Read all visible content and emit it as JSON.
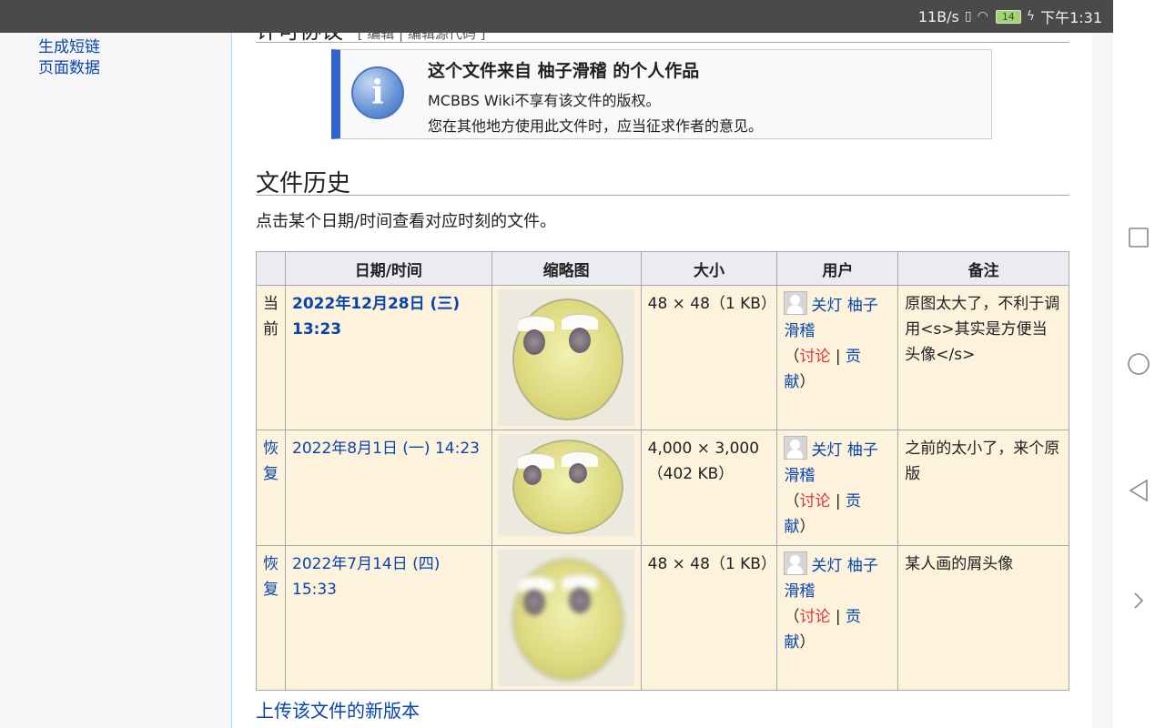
{
  "status_bar": {
    "speed": "11B/s",
    "battery": "14",
    "time": "下午1:31"
  },
  "sidebar": {
    "items": [
      {
        "label": "生成短链"
      },
      {
        "label": "页面数据"
      }
    ]
  },
  "prev_section": {
    "title": "许可协议",
    "edit_links": "[ 编辑 | 编辑源代码 ]"
  },
  "license": {
    "title": "这个文件来自 柚子滑稽 的个人作品",
    "line1": "MCBBS Wiki不享有该文件的版权。",
    "line2": "您在其他地方使用此文件时，应当征求作者的意见。"
  },
  "history": {
    "heading": "文件历史",
    "intro": "点击某个日期/时间查看对应时刻的文件。",
    "columns": [
      "",
      "日期/时间",
      "缩略图",
      "大小",
      "用户",
      "备注"
    ],
    "rows": [
      {
        "status": "当前",
        "date": "2022年12月28日 (三) 13:23",
        "size": "48 × 48（1 KB）",
        "user": "关灯 柚子滑稽",
        "talk": "讨论",
        "contribs": "贡献",
        "comment": "原图太大了，不利于调用<s>其实是方便当头像</s>"
      },
      {
        "status": "恢复",
        "date": "2022年8月1日 (一) 14:23",
        "size": "4,000 × 3,000（402 KB）",
        "user": "关灯 柚子滑稽",
        "talk": "讨论",
        "contribs": "贡献",
        "comment": "之前的太小了，来个原版"
      },
      {
        "status": "恢复",
        "date": "2022年7月14日 (四) 15:33",
        "size": "48 × 48（1 KB）",
        "user": "关灯 柚子滑稽",
        "talk": "讨论",
        "contribs": "贡献",
        "comment": "某人画的屑头像"
      }
    ]
  },
  "upload_new": "上传该文件的新版本"
}
